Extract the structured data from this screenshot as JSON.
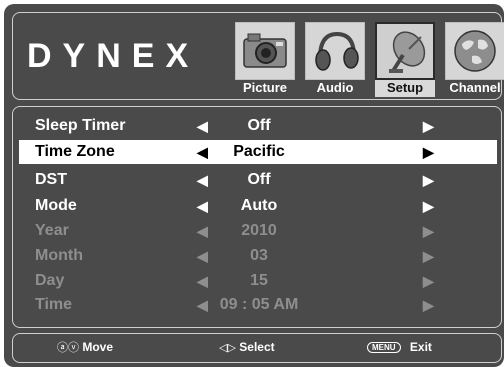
{
  "brand": {
    "name": "DYNEX"
  },
  "tabs": [
    {
      "label": "Picture",
      "icon": "camera-icon",
      "selected": false
    },
    {
      "label": "Audio",
      "icon": "headphones-icon",
      "selected": false
    },
    {
      "label": "Setup",
      "icon": "satellite-dish-icon",
      "selected": true
    },
    {
      "label": "Channel",
      "icon": "globe-icon",
      "selected": false
    }
  ],
  "menu": {
    "rows": [
      {
        "name": "Sleep Timer",
        "value": "Off",
        "arrow_left": "◀",
        "arrow_right": "▶",
        "state": "normal"
      },
      {
        "name": "Time Zone",
        "value": "Pacific",
        "arrow_left": "◀",
        "arrow_right": "▶",
        "state": "highlighted"
      },
      {
        "name": "DST",
        "value": "Off",
        "arrow_left": "◀",
        "arrow_right": "▶",
        "state": "normal"
      },
      {
        "name": "Mode",
        "value": "Auto",
        "arrow_left": "◀",
        "arrow_right": "▶",
        "state": "normal"
      },
      {
        "name": "Year",
        "value": "2010",
        "arrow_left": "◀",
        "arrow_right": "▶",
        "state": "disabled"
      },
      {
        "name": "Month",
        "value": "03",
        "arrow_left": "◀",
        "arrow_right": "▶",
        "state": "disabled"
      },
      {
        "name": "Day",
        "value": "15",
        "arrow_left": "◀",
        "arrow_right": "▶",
        "state": "disabled"
      },
      {
        "name": "Time",
        "value": "09 : 05  AM",
        "arrow_left": "◀",
        "arrow_right": "▶",
        "state": "disabled"
      }
    ]
  },
  "footer": {
    "move_icon": "ⓐⓥ",
    "move_label": "Move",
    "select_icon": "◁▷",
    "select_label": "Select",
    "menu_key": "MENU",
    "exit_label": "Exit"
  },
  "colors": {
    "panel": "#4a4a4a",
    "border": "#cfcfcf",
    "highlight": "#ffffff",
    "disabled_text": "#8e8e8e"
  }
}
